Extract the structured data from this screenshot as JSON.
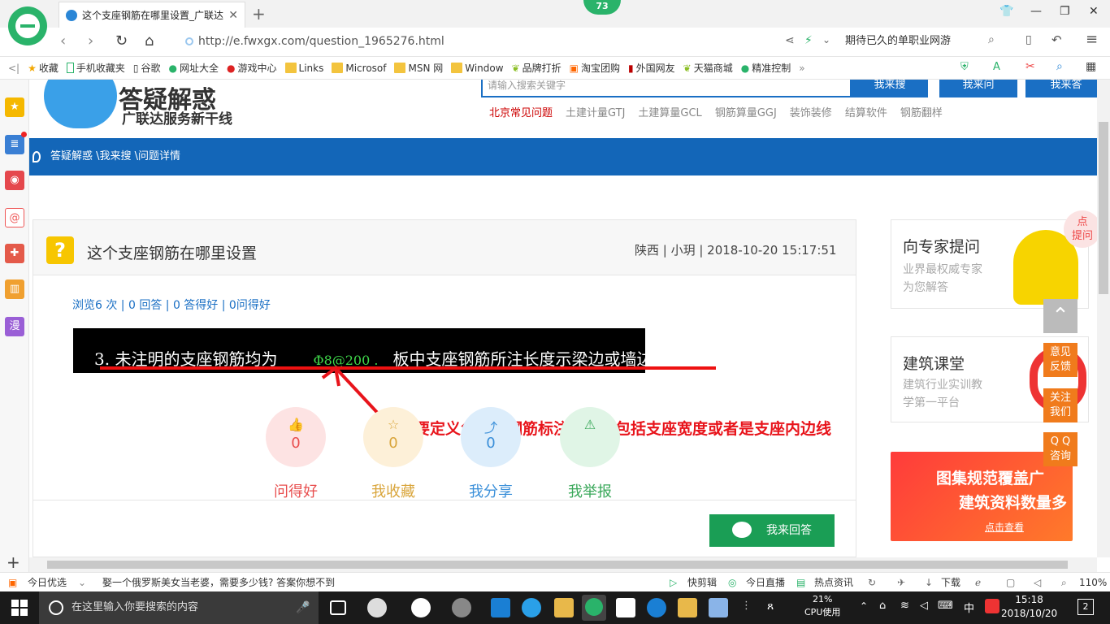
{
  "browser": {
    "tab_title": "这个支座钢筋在哪里设置_广联达",
    "badge_count": "73",
    "url": "http://e.fwxgx.com/question_1965276.html",
    "search_text": "期待已久的单职业网游"
  },
  "favorites": [
    "收藏",
    "手机收藏夹",
    "谷歌",
    "网址大全",
    "游戏中心",
    "Links",
    "Microsof",
    "MSN 网",
    "Window",
    "品牌打折",
    "淘宝团购",
    "外国网友",
    "天猫商城",
    "精准控制"
  ],
  "site": {
    "logo_title": "答疑解惑",
    "logo_sub": "广联达服务新干线",
    "search_placeholder": "请输入搜索关键字",
    "btn_search": "我来搜",
    "btn_ask": "我来问",
    "btn_answer": "我来答",
    "top_links": [
      "北京常见问题",
      "土建计量GTJ",
      "土建算量GCL",
      "钢筋算量GGJ",
      "装饰装修",
      "结算软件",
      "钢筋翻样"
    ],
    "breadcrumb": "答疑解惑 \\我来搜 \\问题详情"
  },
  "question": {
    "title": "这个支座钢筋在哪里设置",
    "meta": "陕西 | 小玥 | 2018-10-20 15:17:51",
    "stats": "浏览6 次 | 0 回答 | 0 答得好 | 0问得好",
    "image_text_1": "3. 未注明的支座钢筋均为",
    "image_text_green": "Φ8@200 .",
    "image_text_2": "板中支座钢筋所注长度示梁边或墙边到弯勾的距离。",
    "annotation": "这是需要定义负筋，钢筋标注长度不包括支座宽度或者是支座内边线",
    "actions": [
      {
        "label": "问得好",
        "count": "0",
        "color": "#e84e4e",
        "bg": "#fde3e3"
      },
      {
        "label": "我收藏",
        "count": "0",
        "color": "#d9a53b",
        "bg": "#fdf0d8"
      },
      {
        "label": "我分享",
        "count": "0",
        "color": "#3a8fd9",
        "bg": "#dcedfb"
      },
      {
        "label": "我举报",
        "count": "",
        "color": "#3aa85a",
        "bg": "#e0f5e6"
      }
    ],
    "answer_btn": "我来回答"
  },
  "sidebar_right": {
    "expert_title": "向专家提问",
    "expert_desc": [
      "业界最权威专家",
      "为您解答"
    ],
    "course_title": "建筑课堂",
    "course_desc": [
      "建筑行业实训教",
      "学第一平台"
    ],
    "feedback": [
      "意见",
      "反馈"
    ],
    "follow": [
      "关注",
      "我们"
    ],
    "qq": [
      "Q Q",
      "咨询"
    ],
    "click_hint": [
      "点",
      "提问"
    ],
    "banner_l1": "图集规范覆盖广",
    "banner_l2": "建筑资料数量多",
    "banner_l3": "点击查看"
  },
  "statusbar": {
    "today": "今日优选",
    "news": "娶一个俄罗斯美女当老婆，需要多少钱? 答案你想不到",
    "items": [
      "快剪辑",
      "今日直播",
      "热点资讯",
      "下载"
    ],
    "zoom": "110%"
  },
  "taskbar": {
    "search_placeholder": "在这里输入你要搜索的内容",
    "cpu_pct": "21%",
    "cpu_label": "CPU使用",
    "ime": "中",
    "time": "15:18",
    "date": "2018/10/20",
    "notif_count": "2"
  }
}
